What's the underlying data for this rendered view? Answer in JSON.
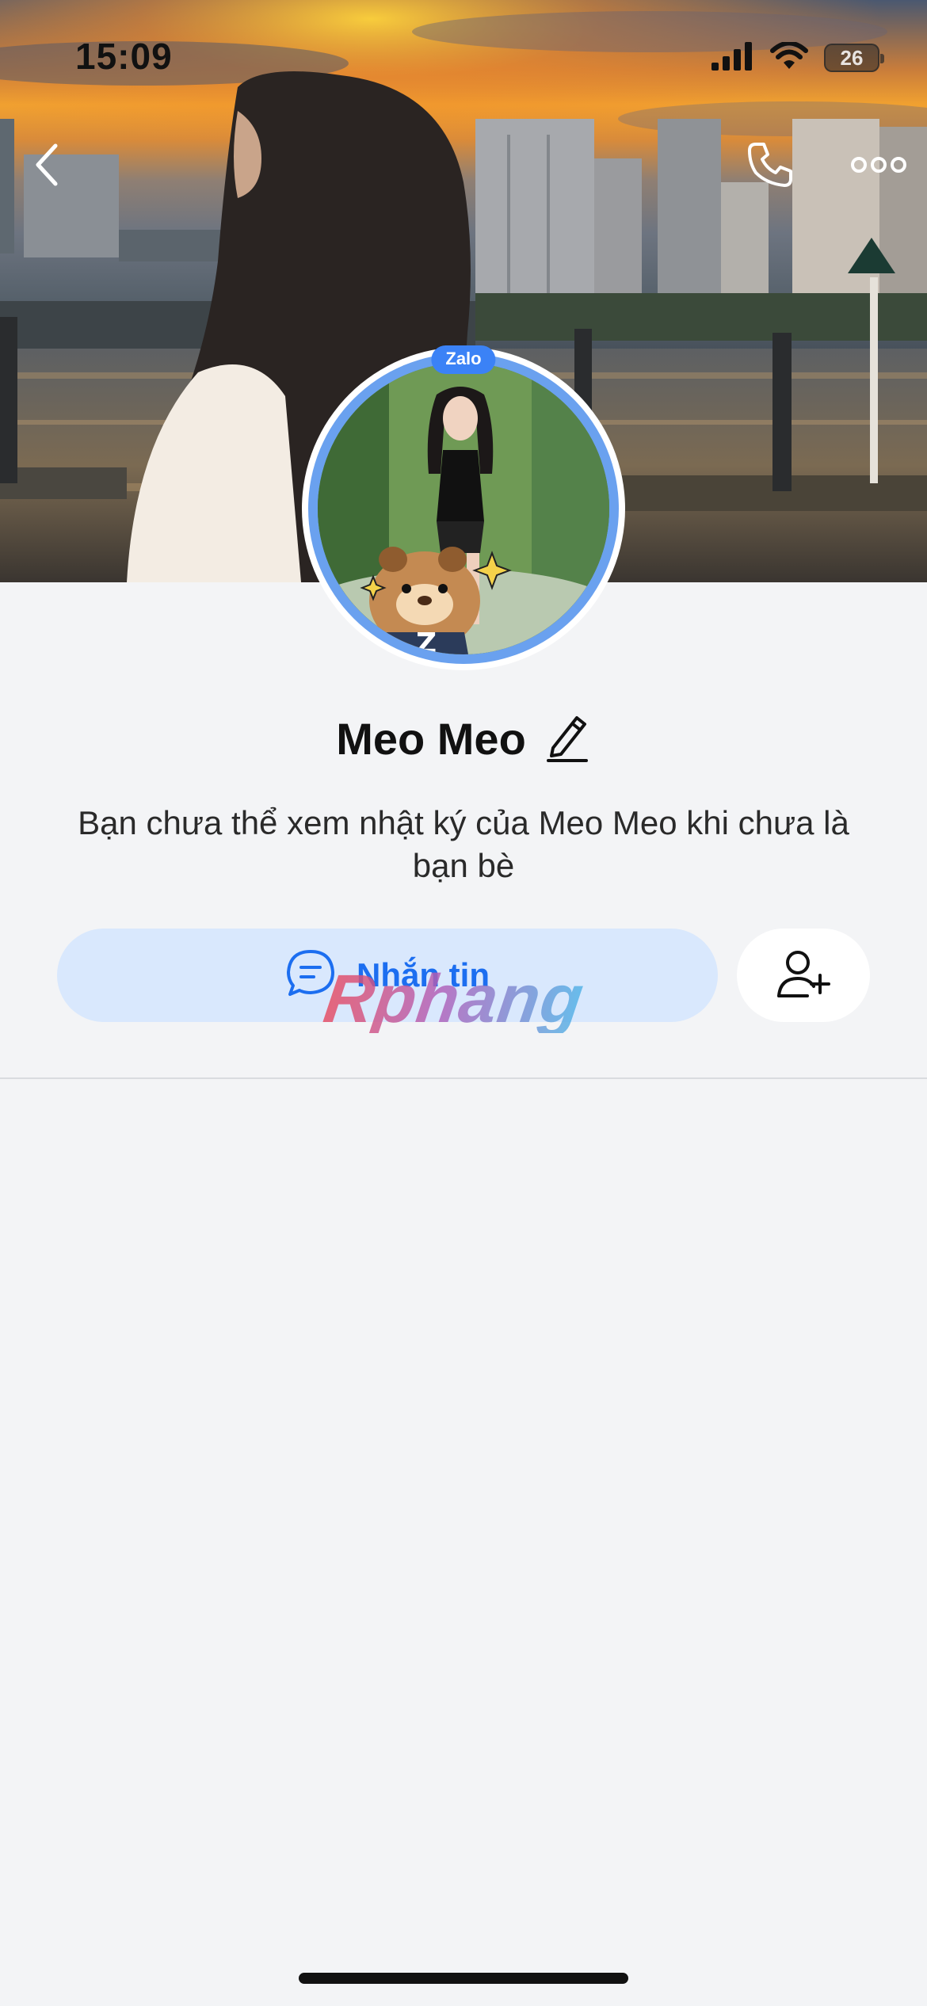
{
  "status_bar": {
    "time": "15:09",
    "battery": "26",
    "icons": [
      "cellular-signal-icon",
      "wifi-icon",
      "battery-icon"
    ]
  },
  "nav": {
    "back_icon": "chevron-left-icon",
    "call_icon": "phone-icon",
    "more_icon": "more-dots-icon"
  },
  "avatar": {
    "badge": "Zalo",
    "ring_color": "#6aa1ef"
  },
  "profile": {
    "name": "Meo Meo",
    "edit_icon": "pencil-icon",
    "diary_note": "Bạn chưa thể xem nhật ký của Meo Meo khi chưa là bạn bè"
  },
  "actions": {
    "message_label": "Nhắn tin",
    "message_icon": "chat-bubble-icon",
    "add_friend_icon": "add-user-icon"
  },
  "watermark": "Rphang",
  "colors": {
    "accent": "#1c6ef0",
    "message_button_bg": "#d9e8fd",
    "page_bg": "#f3f4f6"
  }
}
